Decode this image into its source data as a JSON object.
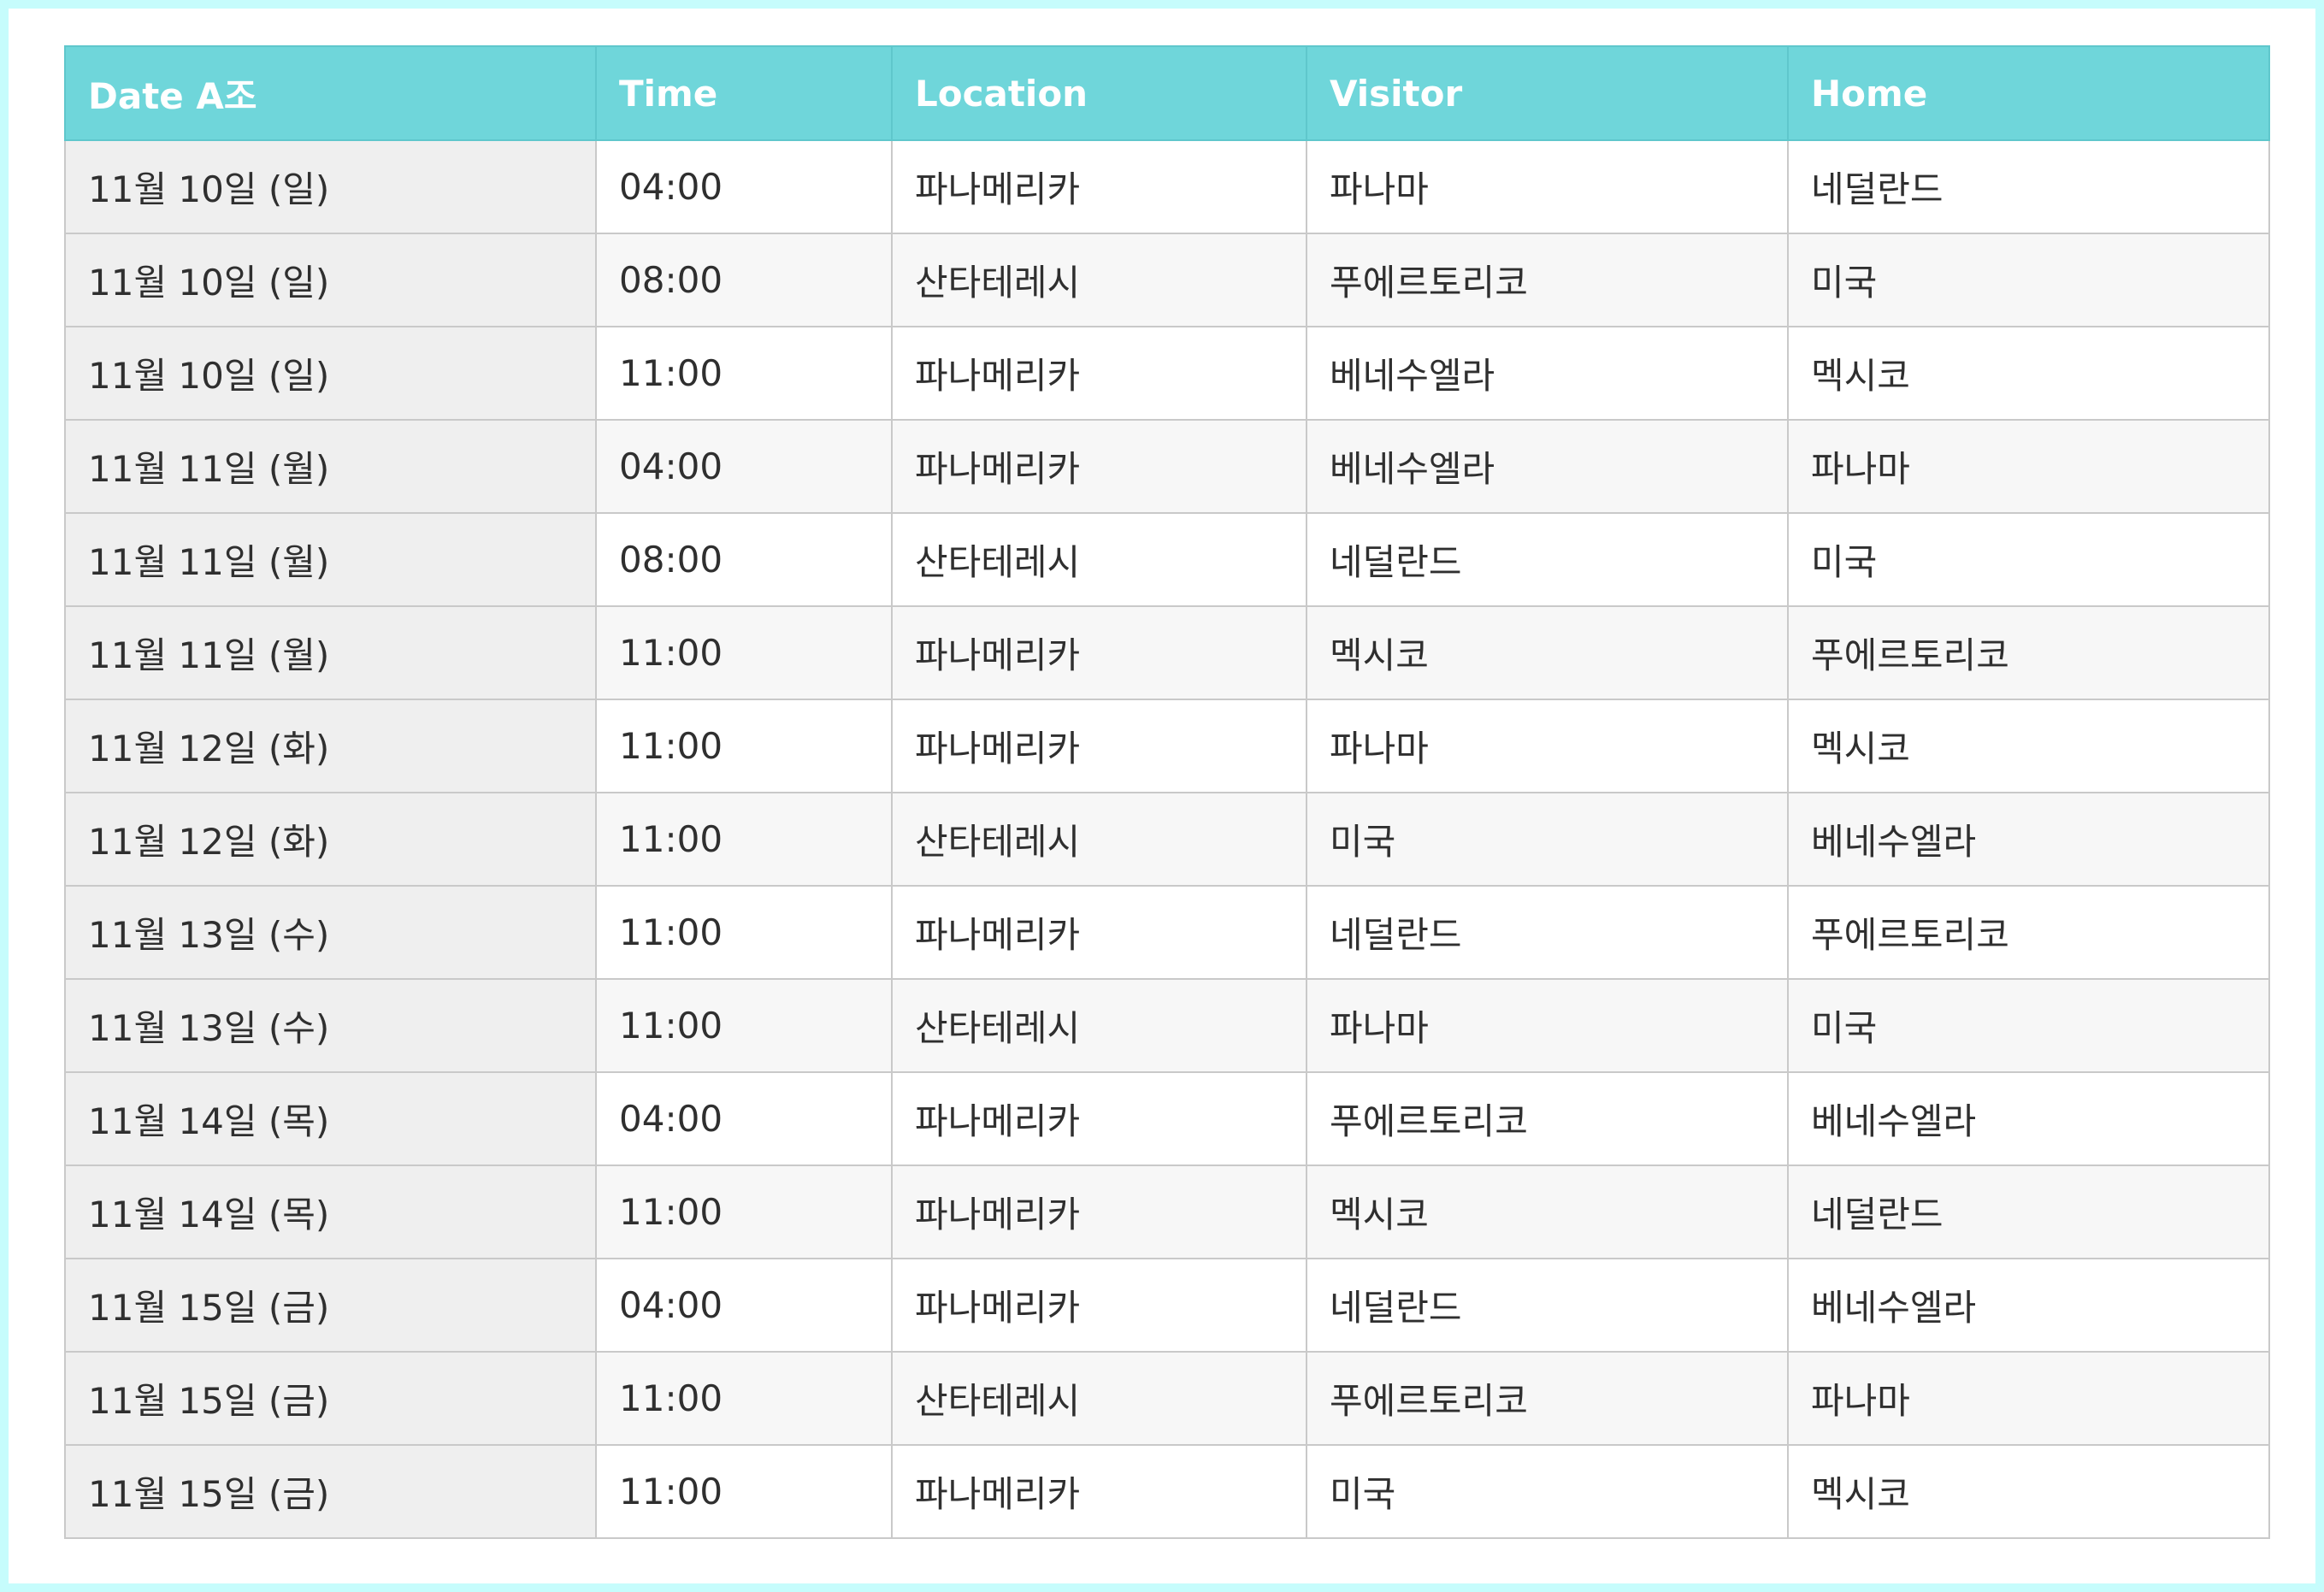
{
  "table": {
    "headers": [
      "Date A조",
      "Time",
      "Location",
      "Visitor",
      "Home"
    ],
    "rows": [
      [
        "11월 10일 (일)",
        "04:00",
        "파나메리카",
        "파나마",
        "네덜란드"
      ],
      [
        "11월 10일 (일)",
        "08:00",
        "산타테레시",
        "푸에르토리코",
        "미국"
      ],
      [
        "11월 10일 (일)",
        "11:00",
        "파나메리카",
        "베네수엘라",
        "멕시코"
      ],
      [
        "11월 11일 (월)",
        "04:00",
        "파나메리카",
        "베네수엘라",
        "파나마"
      ],
      [
        "11월 11일 (월)",
        "08:00",
        "산타테레시",
        "네덜란드",
        "미국"
      ],
      [
        "11월 11일 (월)",
        "11:00",
        "파나메리카",
        "멕시코",
        "푸에르토리코"
      ],
      [
        "11월 12일 (화)",
        "11:00",
        "파나메리카",
        "파나마",
        "멕시코"
      ],
      [
        "11월 12일 (화)",
        "11:00",
        "산타테레시",
        "미국",
        "베네수엘라"
      ],
      [
        "11월 13일 (수)",
        "11:00",
        "파나메리카",
        "네덜란드",
        "푸에르토리코"
      ],
      [
        "11월 13일 (수)",
        "11:00",
        "산타테레시",
        "파나마",
        "미국"
      ],
      [
        "11월 14일 (목)",
        "04:00",
        "파나메리카",
        "푸에르토리코",
        "베네수엘라"
      ],
      [
        "11월 14일 (목)",
        "11:00",
        "파나메리카",
        "멕시코",
        "네덜란드"
      ],
      [
        "11월 15일 (금)",
        "04:00",
        "파나메리카",
        "네덜란드",
        "베네수엘라"
      ],
      [
        "11월 15일 (금)",
        "11:00",
        "산타테레시",
        "푸에르토리코",
        "파나마"
      ],
      [
        "11월 15일 (금)",
        "11:00",
        "파나메리카",
        "미국",
        "멕시코"
      ]
    ]
  },
  "colors": {
    "page_border": "#c6fcfc",
    "header_bg": "#6fd6da",
    "header_text": "#ffffff",
    "date_column_bg": "#efefef",
    "stripe_bg": "#f7f7f7",
    "grid_line": "#c9c9c9",
    "body_text": "#2f2f2f"
  }
}
